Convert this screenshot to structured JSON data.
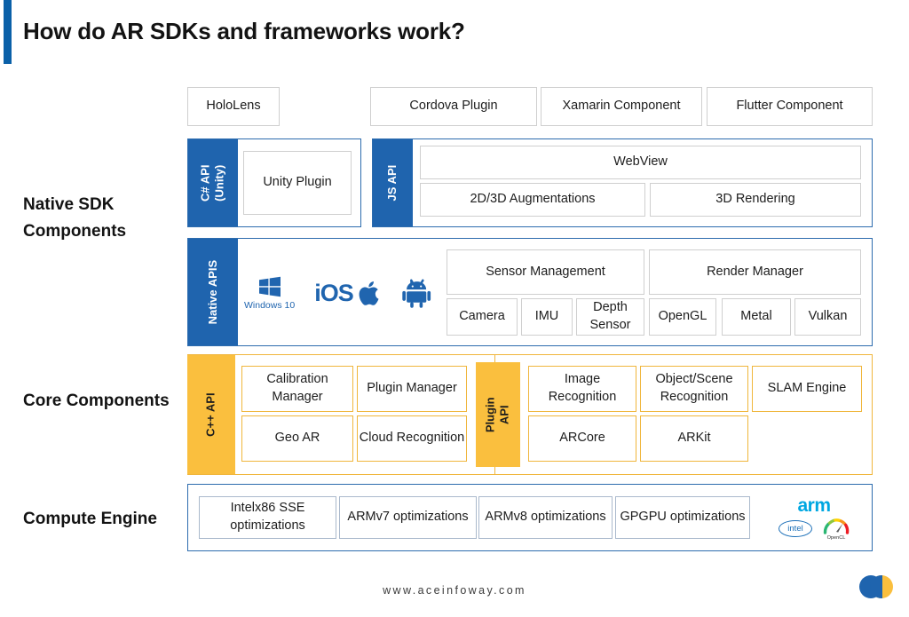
{
  "header": {
    "title": "How do AR SDKs and frameworks work?",
    "accent_color": "#0a60a8"
  },
  "rows": {
    "native_sdk_label": "Native SDK Components",
    "core_label": "Core Components",
    "compute_label": "Compute Engine"
  },
  "platform_boxes": [
    {
      "label": "HoloLens"
    },
    {
      "label": "Cordova Plugin"
    },
    {
      "label": "Xamarin Component"
    },
    {
      "label": "Flutter Component"
    }
  ],
  "native_sdk": {
    "csharp": {
      "api_label_line1": "C# API",
      "api_label_line2": "(Unity)",
      "plugin": "Unity Plugin"
    },
    "js": {
      "api_label": "JS API",
      "webview": "WebView",
      "augmentations": "2D/3D Augmentations",
      "rendering": "3D Rendering"
    },
    "native_apis": {
      "api_label": "Native APIS",
      "os_logos": [
        {
          "icon": "windows-logo-icon",
          "label": "Windows 10"
        },
        {
          "icon": "ios-apple-logo-icon",
          "label": "iOS"
        },
        {
          "icon": "android-robot-logo-icon",
          "label": "Android"
        }
      ],
      "sensor_management": "Sensor Management",
      "render_manager": "Render Manager",
      "sensor_items": [
        "Camera",
        "IMU",
        "Depth Sensor"
      ],
      "render_items": [
        "OpenGL",
        "Metal",
        "Vulkan"
      ]
    }
  },
  "core_components": {
    "cpp": {
      "api_label": "C++ API",
      "items": [
        "Calibration Manager",
        "Plugin Manager",
        "Geo AR",
        "Cloud Recognition"
      ]
    },
    "plugin": {
      "api_label_line1": "Plugin",
      "api_label_line2": "API",
      "items": [
        "Image Recognition",
        "Object/Scene Recognition",
        "SLAM Engine",
        "ARCore",
        "ARKit"
      ]
    }
  },
  "compute_engine": {
    "items": [
      "Intelx86 SSE optimizations",
      "ARMv7 optimizations",
      "ARMv8 optimizations",
      "GPGPU optimizations"
    ],
    "logos": [
      {
        "icon": "arm-logo-icon",
        "label": "arm"
      },
      {
        "icon": "intel-logo-icon",
        "label": "intel"
      },
      {
        "icon": "opencl-logo-icon",
        "label": "OpenCL"
      }
    ]
  },
  "footer": {
    "url": "www.aceinfoway.com",
    "logo_icon": "aceinfoway-logo-icon"
  },
  "colors": {
    "brand_blue": "#1F64AE",
    "brand_gold": "#FABF3E",
    "container_blue_border": "#2d6cae",
    "container_gold_border": "#f0b63c",
    "plate_border": "#cfcfcf"
  }
}
